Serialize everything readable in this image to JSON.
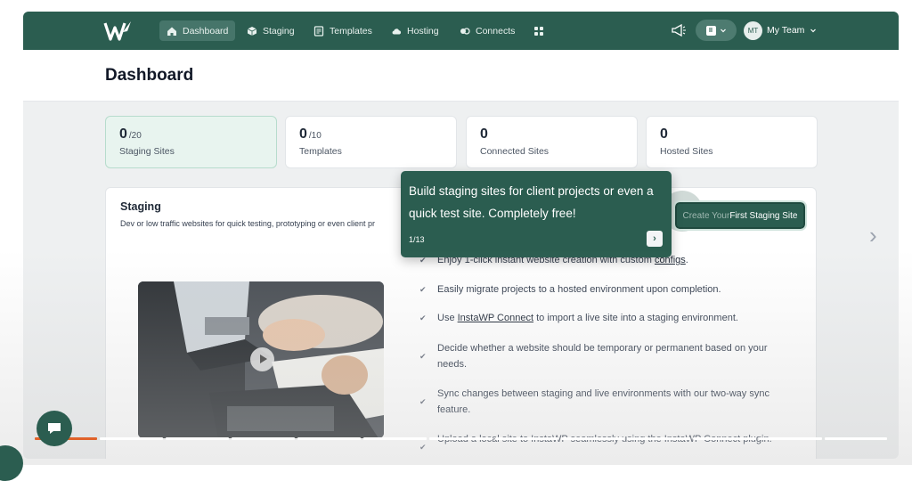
{
  "nav": {
    "items": [
      {
        "label": "Dashboard",
        "icon": "home-icon",
        "active": true
      },
      {
        "label": "Staging",
        "icon": "cube-icon"
      },
      {
        "label": "Templates",
        "icon": "templates-icon"
      },
      {
        "label": "Hosting",
        "icon": "cloud-icon"
      },
      {
        "label": "Connects",
        "icon": "connects-icon"
      }
    ],
    "apps_icon": "grid-icon",
    "announce_icon": "megaphone-icon",
    "switch_chevron": "chevron-down-icon",
    "avatar_initials": "MT",
    "team_label": "My Team"
  },
  "page": {
    "title": "Dashboard"
  },
  "stats": [
    {
      "value": "0",
      "max": "/20",
      "label": "Staging Sites",
      "active": true
    },
    {
      "value": "0",
      "max": "/10",
      "label": "Templates"
    },
    {
      "value": "0",
      "max": "",
      "label": "Connected Sites"
    },
    {
      "value": "0",
      "max": "",
      "label": "Hosted Sites"
    }
  ],
  "staging": {
    "title": "Staging",
    "subtitle": "Dev or low traffic websites for quick testing, prototyping or even client pr",
    "create_dim": "Create Your",
    "create_label": " First Staging Site",
    "features": [
      {
        "pre": "Enjoy 1-click instant website creation with custom ",
        "link": "configs",
        "post": "."
      },
      {
        "pre": "Easily migrate projects to a hosted environment upon completion.",
        "link": "",
        "post": ""
      },
      {
        "pre": "Use ",
        "link": "InstaWP Connect",
        "post": " to import a live site into a staging environment."
      },
      {
        "pre": "Decide whether a website should be temporary or permanent based on your needs.",
        "link": "",
        "post": ""
      },
      {
        "pre": "Sync changes between staging and live environments with our two-way sync feature.",
        "link": "",
        "post": ""
      },
      {
        "pre": "Upload a local site to InstaWP seamlessly using the InstaWP Connect plugin.",
        "link": "",
        "post": ""
      }
    ]
  },
  "tooltip": {
    "text": "Build staging sites for client projects or even a quick test site. Completely free!",
    "step": "1/13",
    "next": "›"
  },
  "colors": {
    "brand": "#2b5d50",
    "accent_progress": "#e0622a"
  }
}
